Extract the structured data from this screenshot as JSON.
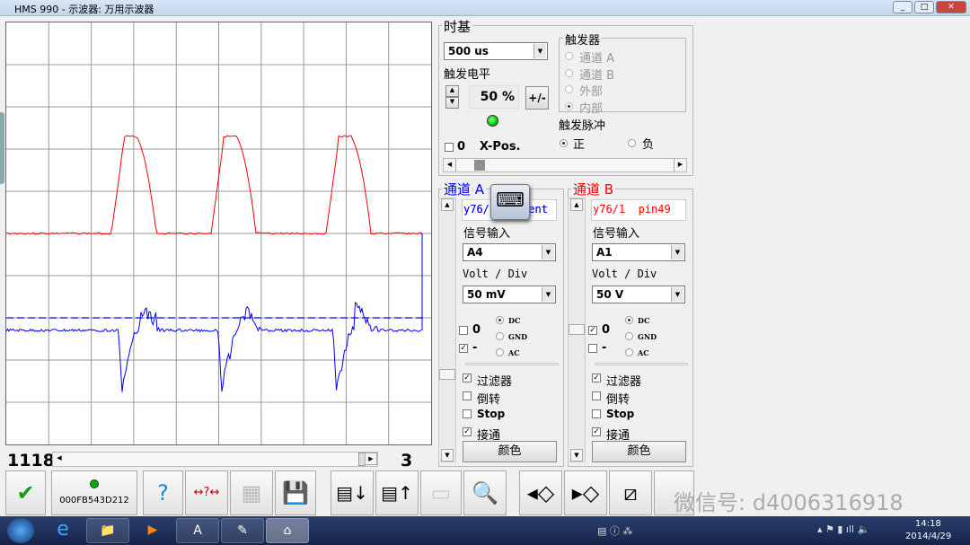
{
  "window": {
    "title": "HMS 990 - 示波器: 万用示波器",
    "controls": [
      "_",
      "□",
      "✕"
    ]
  },
  "timebase": {
    "title": "时基",
    "value": "500 us",
    "trigger_level_label": "触发电平",
    "trigger_level": "50 %",
    "plusminus": "+/-",
    "xpos_zero": "0",
    "xpos_label": "X-Pos.",
    "xpos_checked": false
  },
  "trigger": {
    "title": "触发器",
    "options": [
      "通道 A",
      "通道 B",
      "外部",
      "内部"
    ],
    "selected": "内部",
    "pulse_title": "触发脉冲",
    "pulse_options": [
      "正",
      "负"
    ],
    "pulse_selected": "正"
  },
  "channel_a": {
    "title": "通道 A",
    "color": "#0000ff",
    "name": "y76/1 current",
    "name_visible_left": "y76/",
    "name_visible_right": "rent",
    "input_label": "信号输入",
    "input": "A4",
    "vdiv_label": "Volt / Div",
    "vdiv": "50 mV",
    "zero": "0",
    "zero_checked": false,
    "minus": "-",
    "minus_checked": true,
    "coupling": [
      "DC",
      "GND",
      "AC"
    ],
    "coupling_selected": "DC",
    "filter": "过滤器",
    "filter_checked": true,
    "invert": "倒转",
    "invert_checked": false,
    "stop": "Stop",
    "stop_checked": false,
    "connect": "接通",
    "connect_checked": true,
    "color_btn": "颜色"
  },
  "channel_b": {
    "title": "通道 B",
    "color": "#ff0000",
    "name": "y76/1  pin49",
    "input_label": "信号输入",
    "input": "A1",
    "vdiv_label": "Volt / Div",
    "vdiv": "50 V",
    "zero": "0",
    "zero_checked": true,
    "minus": "-",
    "minus_checked": false,
    "coupling": [
      "DC",
      "GND",
      "AC"
    ],
    "coupling_selected": "DC",
    "filter": "过滤器",
    "filter_checked": true,
    "invert": "倒转",
    "invert_checked": false,
    "stop": "Stop",
    "stop_checked": false,
    "connect": "接通",
    "connect_checked": true,
    "color_btn": "颜色"
  },
  "scroll": {
    "left_value": "1118",
    "right_value": "3"
  },
  "toolbar": {
    "device_id": "000FB543D212",
    "buttons": [
      "ok-check",
      "device-status",
      "help",
      "measure",
      "copy-image",
      "save-gif",
      "export-a",
      "export-b",
      "blank",
      "zoom",
      "shift-left",
      "shift-right",
      "cursor"
    ]
  },
  "watermark": "微信号: d4006316918",
  "taskbar": {
    "time": "14:18",
    "date": "2014/4/29"
  },
  "colors": {
    "trace_a": "#0000ff",
    "trace_b": "#ff0000",
    "led": "#00cc00"
  }
}
